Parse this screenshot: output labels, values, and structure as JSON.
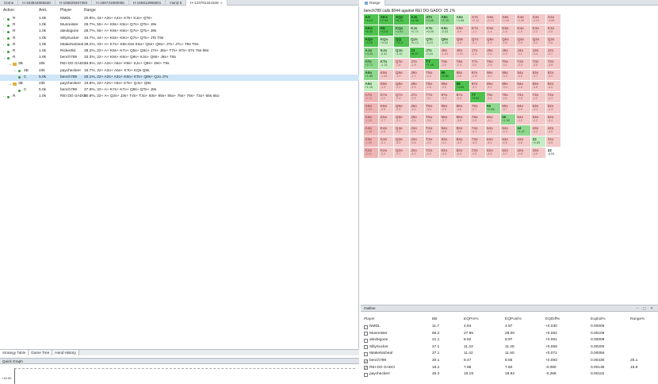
{
  "tabs": [
    {
      "label": "Home",
      "active": false
    },
    {
      "label": "H-153844555630",
      "active": false
    },
    {
      "label": "H-166828467384",
      "active": false
    },
    {
      "label": "H-165731800055",
      "active": false
    },
    {
      "label": "H-166813965801",
      "active": false
    },
    {
      "label": "Hand 5",
      "active": false
    },
    {
      "label": "H-123781344108",
      "active": true
    }
  ],
  "range_tab": {
    "label": "Range"
  },
  "tree": {
    "headers": {
      "action": "Action",
      "amt": "Amt.",
      "player": "Player",
      "range": "Range"
    },
    "rows": [
      {
        "indent": 0,
        "chev": "›",
        "icon": "dot",
        "action": "R",
        "amt": "1.0k",
        "player": "NMDL",
        "range": "20.8%, 44+ A3s+ A4o+ KTs+ KJo+ QTs+",
        "selected": false
      },
      {
        "indent": 0,
        "chev": "›",
        "icon": "dot",
        "action": "R",
        "amt": "1.0k",
        "player": "Munreister",
        "range": "28.7%, 55+ A+ K9s+ K9o+ Q7s+ QTo+ J9s",
        "selected": false
      },
      {
        "indent": 0,
        "chev": "›",
        "icon": "dot",
        "action": "R",
        "amt": "1.0k",
        "player": "alexbigone",
        "range": "28.7%, 55+ A+ K9s+ K9o+ Q7s+ QTo+ J9s",
        "selected": false
      },
      {
        "indent": 0,
        "chev": "›",
        "icon": "dot",
        "action": "R",
        "amt": "1.0k",
        "player": "SillySucker",
        "range": "34.7%, 44+ A+ K5s+ K9o+ Q7s+ QTo+ JTs T9s",
        "selected": false
      },
      {
        "indent": 0,
        "chev": "›",
        "icon": "dot",
        "action": "R",
        "amt": "1.0k",
        "player": "IMakeNoDeal",
        "range": "38.2%, 33+ A+ K7o+ K8s K5s K5o+ Q5s+ Q8o+ J7s+ J7o+ T8s T9o",
        "selected": false
      },
      {
        "indent": 0,
        "chev": "›",
        "icon": "dot",
        "action": "R",
        "amt": "1.0k",
        "player": "RickerB4",
        "range": "38.2%, 22+ A+ K5s+ K7o+ Q5s+ Q8o+ J7s+ J8o+ T7s+ 97s+ 87s 76s 65s",
        "selected": false
      },
      {
        "indent": 0,
        "chev": "⌄",
        "icon": "dot",
        "action": "R",
        "amt": "1.0k",
        "player": "bench789",
        "range": "33.3%, 22+ A+ K5s+ K9o+ Q8s+ K3o+ Q8s+ J8s+ T8s",
        "selected": false
      },
      {
        "indent": 1,
        "chev": "⌄",
        "icon": "folder",
        "action": "3B",
        "amt": "20k",
        "player": "REI DO GADO",
        "range": "19.8%, 22+ A2s+ A6o+ K9s+ KJo+ Q9s+ J9s+ T9s",
        "selected": false
      },
      {
        "indent": 2,
        "chev": "›",
        "icon": "dot",
        "action": "4B",
        "amt": "23k",
        "player": "paycheckerr",
        "range": "15.7%, 22+ A3o+ A6o+ KTo+ KQs Q8s",
        "selected": false
      },
      {
        "indent": 2,
        "chev": "",
        "icon": "dot",
        "action": "C",
        "amt": "5.0k",
        "player": "bench789",
        "range": "25.1%, 22+ A2s+ A3o+ K8o+ KTo+ Q8s+ QJo J7s",
        "selected": true
      },
      {
        "indent": 1,
        "chev": "⌄",
        "icon": "folder",
        "action": "3B",
        "amt": "23k",
        "player": "paycheckerr",
        "range": "19.8%, 22+ A2s+ A6o+ KTo+ QJo+ Q8s",
        "selected": false
      },
      {
        "indent": 2,
        "chev": "",
        "icon": "dot",
        "action": "C",
        "amt": "5.0k",
        "player": "bench789",
        "range": "27.8%, 22+ A+ K7s+ K7o+ Q8s+ QTo+ J8s",
        "selected": false
      },
      {
        "indent": 0,
        "chev": "›",
        "icon": "dot",
        "action": "R",
        "amt": "1.0k",
        "player": "REI DO GADO",
        "range": "80.8%, 22+ A+ Q2s+ J3s+ T4s+ T3o+ 93s+ 85s+ 85o+ 75s+ 76s+ 73o+ 65s 65o",
        "selected": false
      }
    ]
  },
  "left_bottom_tabs": [
    "Strategy Table",
    "Game Tree",
    "Hand History"
  ],
  "quick_graph": {
    "title": "Quick Graph",
    "axis_label": "+15.00"
  },
  "range": {
    "caption": "bench789 calls 8044 against REI DO GADO: 25.1%",
    "cells": [
      [
        [
          "AA",
          "+14.2",
          "g3"
        ],
        [
          "AKs",
          "+7.04",
          "g3"
        ],
        [
          "AQs",
          "+6.12",
          "g3"
        ],
        [
          "AJs",
          "+4.96",
          "g3"
        ],
        [
          "ATs",
          "+3.45",
          "g2"
        ],
        [
          "A9s",
          "+2.10",
          "g2"
        ],
        [
          "A8s",
          "+1.88",
          "g1"
        ],
        [
          "A7s",
          "+0.12",
          "r1"
        ],
        [
          "A6s",
          "-0.13",
          "r1"
        ],
        [
          "A5s",
          "-0.28",
          "r1"
        ],
        [
          "A4s",
          "-0.46",
          "r1"
        ],
        [
          "A3s",
          "-0.31",
          "r1"
        ],
        [
          "A2s",
          "-0.88",
          "r1"
        ]
      ],
      [
        [
          "AKo",
          "+6.32",
          "g3"
        ],
        [
          "KK",
          "+12.8",
          "g3"
        ],
        [
          "KQs",
          "+1.92",
          "g2"
        ],
        [
          "KJs",
          "+0.74",
          "g1"
        ],
        [
          "KTs",
          "+0.09",
          "g1"
        ],
        [
          "K9s",
          "-0.03",
          "g1"
        ],
        [
          "K8s",
          "-0.9",
          "r1"
        ],
        [
          "K7s",
          "-1.1",
          "r1"
        ],
        [
          "K6s",
          "-1.4",
          "r1"
        ],
        [
          "K5s",
          "-1.6",
          "r1"
        ],
        [
          "K4s",
          "-1.9",
          "r1"
        ],
        [
          "K3s",
          "-2.2",
          "r1"
        ],
        [
          "K2s",
          "-2.6",
          "r1"
        ]
      ],
      [
        [
          "AQo",
          "+5.29",
          "g3"
        ],
        [
          "KQo",
          "+0.24",
          "g1"
        ],
        [
          "QQ",
          "+11.0",
          "g3"
        ],
        [
          "QJs",
          "+0.13",
          "g1"
        ],
        [
          "QTs",
          "-0.10",
          "g1"
        ],
        [
          "Q9s",
          "-1.03",
          "g1"
        ],
        [
          "Q8s",
          "-1.8",
          "r1"
        ],
        [
          "Q7s",
          "-2.1",
          "r1"
        ],
        [
          "Q6s",
          "-2.4",
          "r1"
        ],
        [
          "Q5s",
          "-2.6",
          "r1"
        ],
        [
          "Q4s",
          "-2.9",
          "r1"
        ],
        [
          "Q3s",
          "-3.2",
          "r1"
        ],
        [
          "Q2s",
          "-3.5",
          "r1"
        ]
      ],
      [
        [
          "AJo",
          "+4.00",
          "g2"
        ],
        [
          "KJo",
          "-0.42",
          "g1"
        ],
        [
          "QJo",
          "-1.10",
          "g1"
        ],
        [
          "JJ",
          "+8.97",
          "g3"
        ],
        [
          "JTs",
          "-0.24",
          "g1"
        ],
        [
          "J9s",
          "-1.61",
          "r1"
        ],
        [
          "J8s",
          "-1.91",
          "r1"
        ],
        [
          "J7s",
          "-2.3",
          "r1"
        ],
        [
          "J6s",
          "-2.6",
          "r1"
        ],
        [
          "J5s",
          "-2.9",
          "r1"
        ],
        [
          "J4s",
          "-3.1",
          "r1"
        ],
        [
          "J3s",
          "-3.4",
          "r1"
        ],
        [
          "J2s",
          "-3.7",
          "r1"
        ]
      ],
      [
        [
          "ATo",
          "+2.71",
          "g2"
        ],
        [
          "KTo",
          "-1.13",
          "g1"
        ],
        [
          "QTo",
          "-1.6",
          "r1"
        ],
        [
          "JTo",
          "-1.8",
          "r1"
        ],
        [
          "TT",
          "+7.45",
          "g3"
        ],
        [
          "T9s",
          "-2.0",
          "r1"
        ],
        [
          "T8s",
          "-2.3",
          "r1"
        ],
        [
          "T7s",
          "-2.6",
          "r1"
        ],
        [
          "T6s",
          "-2.9",
          "r1"
        ],
        [
          "T5s",
          "-3.1",
          "r1"
        ],
        [
          "T4s",
          "-3.3",
          "r1"
        ],
        [
          "T3s",
          "-3.5",
          "r1"
        ],
        [
          "T2s",
          "-3.8",
          "r1"
        ]
      ],
      [
        [
          "A9o",
          "+1.96",
          "g2"
        ],
        [
          "K9o",
          "-1.45",
          "r1"
        ],
        [
          "Q9o",
          "-1.9",
          "r1"
        ],
        [
          "J9o",
          "-2.2",
          "r1"
        ],
        [
          "T9o",
          "-2.4",
          "r1"
        ],
        [
          "99",
          "+5.81",
          "g3"
        ],
        [
          "98s",
          "-2.5",
          "r1"
        ],
        [
          "97s",
          "-2.8",
          "r1"
        ],
        [
          "96s",
          "-3.0",
          "r1"
        ],
        [
          "95s",
          "-3.3",
          "r1"
        ],
        [
          "94s",
          "-3.5",
          "r1"
        ],
        [
          "93s",
          "-3.7",
          "r1"
        ],
        [
          "92s",
          "-3.9",
          "r1"
        ]
      ],
      [
        [
          "A8o",
          "+1.16",
          "g1"
        ],
        [
          "K8o",
          "-1.9",
          "r1"
        ],
        [
          "Q8o",
          "-2.3",
          "r1"
        ],
        [
          "J8o",
          "-2.6",
          "r1"
        ],
        [
          "T8o",
          "-2.8",
          "r1"
        ],
        [
          "98o",
          "-3.0",
          "r1"
        ],
        [
          "88",
          "+4.69",
          "g3"
        ],
        [
          "87s",
          "-3.0",
          "r1"
        ],
        [
          "86s",
          "-3.2",
          "r1"
        ],
        [
          "85s",
          "-3.4",
          "r1"
        ],
        [
          "84s",
          "-3.6",
          "r1"
        ],
        [
          "83s",
          "-3.8",
          "r1"
        ],
        [
          "82s",
          "-4.0",
          "r1"
        ]
      ],
      [
        [
          "A7o",
          "-0.72",
          "r2"
        ],
        [
          "K7o",
          "-2.2",
          "r1"
        ],
        [
          "Q7o",
          "-2.6",
          "r1"
        ],
        [
          "J7o",
          "-2.9",
          "r1"
        ],
        [
          "T7o",
          "-3.1",
          "r1"
        ],
        [
          "97o",
          "-3.3",
          "r1"
        ],
        [
          "87o",
          "-3.4",
          "r1"
        ],
        [
          "77",
          "+3.82",
          "g3"
        ],
        [
          "76s",
          "-3.4",
          "r1"
        ],
        [
          "75s",
          "-3.6",
          "r1"
        ],
        [
          "74s",
          "-3.8",
          "r1"
        ],
        [
          "73s",
          "-4.0",
          "r1"
        ],
        [
          "72s",
          "-4.2",
          "r1"
        ]
      ],
      [
        [
          "A6o",
          "-1.03",
          "r2"
        ],
        [
          "K6o",
          "-2.5",
          "r1"
        ],
        [
          "Q6o",
          "-2.9",
          "r1"
        ],
        [
          "J6o",
          "-3.2",
          "r1"
        ],
        [
          "T6o",
          "-3.4",
          "r1"
        ],
        [
          "96o",
          "-3.5",
          "r1"
        ],
        [
          "86o",
          "-3.6",
          "r1"
        ],
        [
          "76o",
          "-3.7",
          "r1"
        ],
        [
          "66",
          "+2.68",
          "g2"
        ],
        [
          "65s",
          "-3.7",
          "r1"
        ],
        [
          "64s",
          "-3.9",
          "r1"
        ],
        [
          "63s",
          "-4.1",
          "r1"
        ],
        [
          "62s",
          "-4.3",
          "r1"
        ]
      ],
      [
        [
          "A5o",
          "-1.00",
          "r2"
        ],
        [
          "K5o",
          "-2.7",
          "r1"
        ],
        [
          "Q5o",
          "-3.1",
          "r1"
        ],
        [
          "J5o",
          "-3.4",
          "r1"
        ],
        [
          "T5o",
          "-3.6",
          "r1"
        ],
        [
          "95o",
          "-3.7",
          "r1"
        ],
        [
          "85o",
          "-3.8",
          "r1"
        ],
        [
          "75o",
          "-3.9",
          "r1"
        ],
        [
          "65o",
          "-4.0",
          "r1"
        ],
        [
          "55",
          "+1.99",
          "g2"
        ],
        [
          "54s",
          "-4.0",
          "r1"
        ],
        [
          "53s",
          "-4.2",
          "r1"
        ],
        [
          "52s",
          "-4.4",
          "r1"
        ]
      ],
      [
        [
          "A4o",
          "-1.35",
          "r2"
        ],
        [
          "K4o",
          "-2.9",
          "r1"
        ],
        [
          "Q4o",
          "-3.3",
          "r1"
        ],
        [
          "J4o",
          "-3.6",
          "r1"
        ],
        [
          "T4o",
          "-3.8",
          "r1"
        ],
        [
          "94o",
          "-3.9",
          "r1"
        ],
        [
          "84o",
          "-4.0",
          "r1"
        ],
        [
          "74o",
          "-4.1",
          "r1"
        ],
        [
          "64o",
          "-4.2",
          "r1"
        ],
        [
          "54o",
          "-4.3",
          "r1"
        ],
        [
          "44",
          "+1.47",
          "g2"
        ],
        [
          "43s",
          "-4.3",
          "r1"
        ],
        [
          "42s",
          "-4.5",
          "r1"
        ]
      ],
      [
        [
          "A3o",
          "-1.69",
          "r2"
        ],
        [
          "K3o",
          "-3.1",
          "r1"
        ],
        [
          "Q3o",
          "-3.5",
          "r1"
        ],
        [
          "J3o",
          "-3.8",
          "r1"
        ],
        [
          "T3o",
          "-4.0",
          "r1"
        ],
        [
          "93o",
          "-4.1",
          "r1"
        ],
        [
          "83o",
          "-4.2",
          "r1"
        ],
        [
          "73o",
          "-4.3",
          "r1"
        ],
        [
          "63o",
          "-4.4",
          "r1"
        ],
        [
          "53o",
          "-4.5",
          "r1"
        ],
        [
          "43o",
          "-4.6",
          "r1"
        ],
        [
          "33",
          "+0.83",
          "g1"
        ],
        [
          "32s",
          "-4.6",
          "r1"
        ]
      ],
      [
        [
          "A2o",
          "-2.01",
          "r2"
        ],
        [
          "K2o",
          "-3.3",
          "r1"
        ],
        [
          "Q2o",
          "-3.7",
          "r1"
        ],
        [
          "J2o",
          "-4.0",
          "r1"
        ],
        [
          "T2o",
          "-4.2",
          "r1"
        ],
        [
          "92o",
          "-4.3",
          "r1"
        ],
        [
          "82o",
          "-4.4",
          "r1"
        ],
        [
          "72o",
          "-4.5",
          "r1"
        ],
        [
          "62o",
          "-4.6",
          "r1"
        ],
        [
          "52o",
          "-4.7",
          "r1"
        ],
        [
          "42o",
          "-4.8",
          "r1"
        ],
        [
          "32o",
          "-4.9",
          "r1"
        ],
        [
          "22",
          "-0.04",
          "w"
        ]
      ]
    ]
  },
  "outline": {
    "tab_label": "Outline",
    "window_buttons": "– ▢ ✕",
    "headers": {
      "player": "Player",
      "bb": "BB",
      "eqpre": "EQPre%",
      "eqpost": "EQPost%",
      "eqdiff": "EQDiff%",
      "exploit": "Exploit%",
      "range": "Range%"
    },
    "rows": [
      {
        "checked": false,
        "player": "NMDL",
        "bb": "11.7",
        "eqpre": "4.94",
        "eqpost": "4.97",
        "eqdiff": "+0.030",
        "exploit": "0.00005",
        "range": ""
      },
      {
        "checked": false,
        "player": "Munreister",
        "bb": "66.2",
        "eqpre": "27.95",
        "eqpost": "28.00",
        "eqdiff": "+0.052",
        "exploit": "0.00109",
        "range": ""
      },
      {
        "checked": false,
        "player": "alexbigone",
        "bb": "21.1",
        "eqpre": "8.92",
        "eqpost": "8.97",
        "eqdiff": "+0.051",
        "exploit": "0.00009",
        "range": ""
      },
      {
        "checked": false,
        "player": "SillySucker",
        "bb": "27.1",
        "eqpre": "11.43",
        "eqpost": "11.48",
        "eqdiff": "+0.059",
        "exploit": "0.00200",
        "range": ""
      },
      {
        "checked": false,
        "player": "IMakeNoDeal",
        "bb": "27.1",
        "eqpre": "11.42",
        "eqpost": "11.50",
        "eqdiff": "+0.071",
        "exploit": "0.00056",
        "range": ""
      },
      {
        "checked": true,
        "player": "bench789",
        "bb": "20.1",
        "eqpre": "8.47",
        "eqpost": "8.55",
        "eqdiff": "+0.083",
        "exploit": "0.00430",
        "range": "25.1"
      },
      {
        "checked": true,
        "player": "REI DO GADO",
        "bb": "18.2",
        "eqpre": "7.68",
        "eqpost": "7.60",
        "eqdiff": "-0.080",
        "exploit": "0.00135",
        "range": "19.8"
      },
      {
        "checked": false,
        "player": "paycheckerr",
        "bb": "45.3",
        "eqpre": "19.19",
        "eqpost": "18.92",
        "eqdiff": "-0.266",
        "exploit": "0.00116",
        "range": ""
      }
    ]
  }
}
